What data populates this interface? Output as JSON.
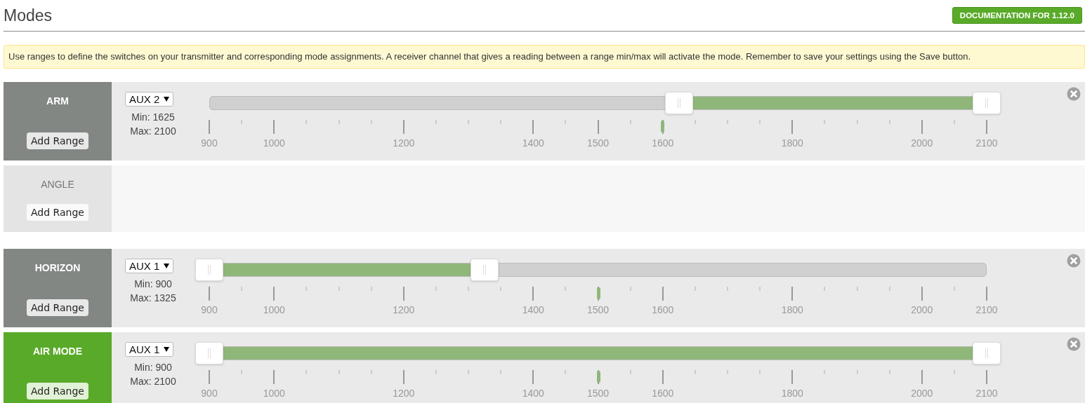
{
  "title": "Modes",
  "doc_button": "DOCUMENTATION FOR 1.12.0",
  "note": "Use ranges to define the switches on your transmitter and corresponding mode assignments. A receiver channel that gives a reading between a range min/max will activate the mode. Remember to save your settings using the Save button.",
  "modes": [
    {
      "name": "ARM",
      "active": false,
      "add_button": "Add Range",
      "ranges": [
        {
          "channel": "AUX 2",
          "min_label": "Min:",
          "min": "1625",
          "max_label": "Max:",
          "max": "2100",
          "level": 0.583,
          "scale": [
            "900",
            "1000",
            "1200",
            "1400",
            "1500",
            "1600",
            "1800",
            "2000",
            "2100"
          ]
        }
      ]
    },
    {
      "name": "ANGLE",
      "active": false,
      "add_button": "Add Range"
    },
    {
      "name": "HORIZON",
      "active": false,
      "add_button": "Add Range",
      "ranges": [
        {
          "channel": "AUX 1",
          "min_label": "Min:",
          "min": "900",
          "max_label": "Max:",
          "max": "1325",
          "level": 0.5,
          "scale": [
            "900",
            "1000",
            "1200",
            "1400",
            "1500",
            "1600",
            "1800",
            "2000",
            "2100"
          ]
        }
      ]
    },
    {
      "name": "AIR MODE",
      "active": true,
      "add_button": "Add Range",
      "ranges": [
        {
          "channel": "AUX 1",
          "min_label": "Min:",
          "min": "900",
          "max_label": "Max:",
          "max": "2100",
          "level": 0.5,
          "scale": [
            "900",
            "1000",
            "1200",
            "1400",
            "1500",
            "1600",
            "1800",
            "2000",
            "2100"
          ]
        }
      ]
    }
  ]
}
